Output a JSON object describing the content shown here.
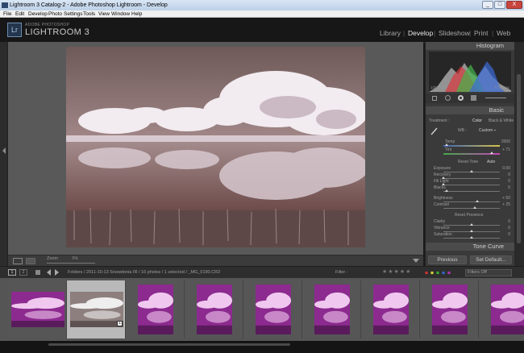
{
  "window": {
    "title": "Lightroom 3 Catalog-2 - Adobe Photoshop Lightroom - Develop",
    "min": "_",
    "max": "□",
    "close": "X"
  },
  "menu": [
    "File",
    "Edit",
    "Develop",
    "Photo",
    "Settings",
    "Tools",
    "View",
    "Window",
    "Help"
  ],
  "brand": {
    "logo": "Lr",
    "small": "ADOBE PHOTOSHOP",
    "big": "LIGHTROOM 3"
  },
  "modules": [
    "Library",
    "Develop",
    "Slideshow",
    "Print",
    "Web"
  ],
  "active_module": "Develop",
  "toolbar": {
    "zoom_label": "Zoom",
    "zoom_value": "Fit"
  },
  "histogram": {
    "title": "Histogram",
    "left_info": "1/200 sec",
    "right_info": "f / 10 sec",
    "colors": {
      "red": "#d7383c",
      "green": "#43b54a",
      "blue": "#3c6bd8",
      "gray": "#a7a7a7"
    }
  },
  "basic": {
    "title": "Basic",
    "treatment_label": "Treatment :",
    "treatment_color": "Color",
    "treatment_bw": "Black & White",
    "wb_label": "WB :",
    "wb_value": "Custom ÷",
    "temp": {
      "label": "Temp",
      "value": "2000",
      "level": 0.05
    },
    "tint": {
      "label": "Tint",
      "value": "+ 71",
      "level": 0.86
    },
    "tone_label": "Reset Tone",
    "tone_auto": "Auto",
    "exposure": {
      "label": "Exposure",
      "value": "0.00",
      "level": 0.5
    },
    "recovery": {
      "label": "Recovery",
      "value": "0",
      "level": 0.0
    },
    "fill": {
      "label": "Fill Light",
      "value": "0",
      "level": 0.0
    },
    "blacks": {
      "label": "Blacks",
      "value": "5",
      "level": 0.05
    },
    "brightness": {
      "label": "Brightness",
      "value": "+ 50",
      "level": 0.6
    },
    "contrast": {
      "label": "Contrast",
      "value": "+ 25",
      "level": 0.55
    },
    "presence_label": "Reset Presence",
    "clarity": {
      "label": "Clarity",
      "value": "0",
      "level": 0.5
    },
    "vibrance": {
      "label": "Vibrance",
      "value": "0",
      "level": 0.5
    },
    "saturation": {
      "label": "Saturation",
      "value": "0",
      "level": 0.5
    }
  },
  "tone_curve": {
    "title": "Tone Curve"
  },
  "buttons": {
    "previous": "Previous",
    "set_default": "Set Default..."
  },
  "filmbar": {
    "page1": "1",
    "page2": "2",
    "path": "Folders / 2011-10-13 Snowdonia IR / 16 photos / 1 selected / _MG_0190.CR2",
    "filter_label": "Filter :",
    "stars": "★★★★★",
    "filters_off": "Filters Off"
  },
  "filmstrip": {
    "count": 9,
    "selected_index": 1,
    "badge": "1"
  }
}
